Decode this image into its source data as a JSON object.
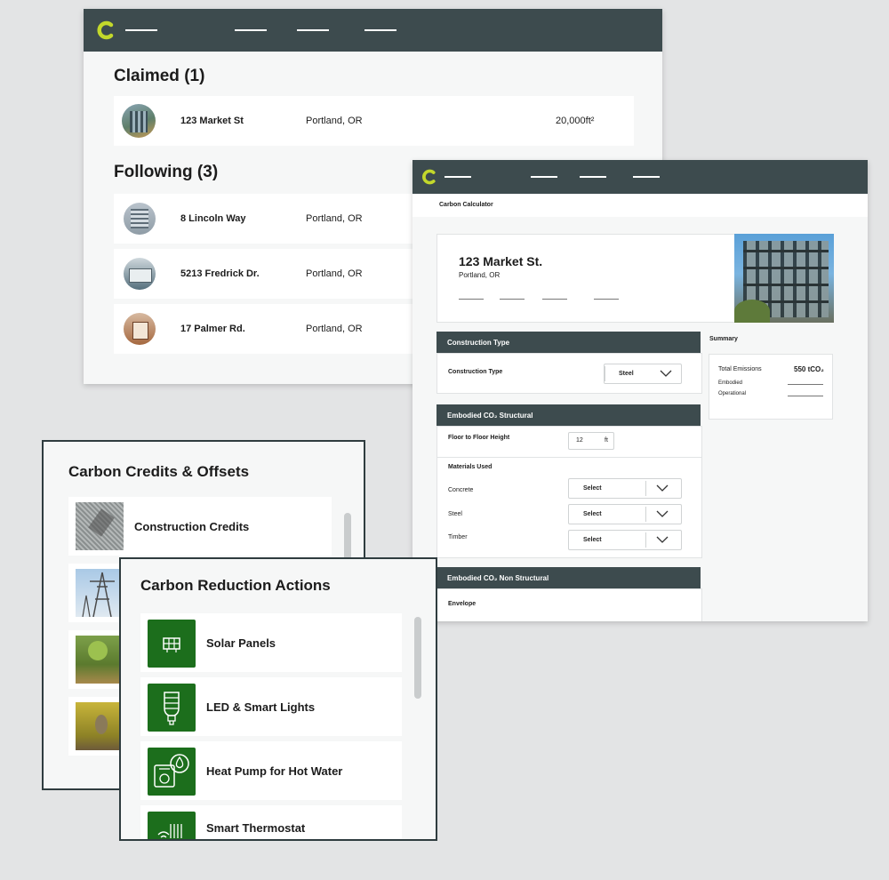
{
  "colors": {
    "bar": "#3d4b4e",
    "accent": "#c3d82b",
    "green": "#1c6e1c",
    "bg": "#e3e4e5"
  },
  "properties": {
    "claimed_heading": "Claimed (1)",
    "following_heading": "Following (3)",
    "claimed": [
      {
        "address": "123 Market St",
        "city": "Portland, OR",
        "area": "20,000ft²"
      }
    ],
    "following": [
      {
        "address": "8 Lincoln Way",
        "city": "Portland, OR"
      },
      {
        "address": "5213 Fredrick Dr.",
        "city": "Portland, OR"
      },
      {
        "address": "17 Palmer Rd.",
        "city": "Portland, OR"
      }
    ]
  },
  "calculator": {
    "breadcrumb": "Carbon Calculator",
    "building_name": "123 Market St.",
    "building_city": "Portland, OR",
    "construction_type_header": "Construction Type",
    "construction_type_label": "Construction Type",
    "construction_type_value": "Steel",
    "summary_label": "Summary",
    "total_emissions_label": "Total Emissions",
    "total_emissions_value": "550 tCO₂",
    "embodied_label": "Embodied",
    "operational_label": "Operational",
    "structural_header": "Embodied CO₂ Structural",
    "floor_height_label": "Floor to Floor Height",
    "floor_height_value": "12",
    "floor_height_unit": "ft",
    "materials_label": "Materials Used",
    "materials": [
      {
        "name": "Concrete",
        "value": "Select"
      },
      {
        "name": "Steel",
        "value": "Select"
      },
      {
        "name": "Timber",
        "value": "Select"
      }
    ],
    "nonstructural_header": "Embodied CO₂ Non Structural",
    "envelope_label": "Envelope"
  },
  "credits": {
    "title": "Carbon Credits & Offsets",
    "items": [
      {
        "label": "Construction Credits"
      }
    ]
  },
  "actions": {
    "title": "Carbon Reduction Actions",
    "items": [
      {
        "label": "Solar Panels",
        "icon": "solar-panel-icon"
      },
      {
        "label": "LED & Smart Lights",
        "icon": "light-bulb-icon"
      },
      {
        "label": "Heat Pump for Hot Water",
        "icon": "heat-pump-icon"
      },
      {
        "label": "Smart Thermostat",
        "icon": "thermostat-icon"
      }
    ]
  }
}
